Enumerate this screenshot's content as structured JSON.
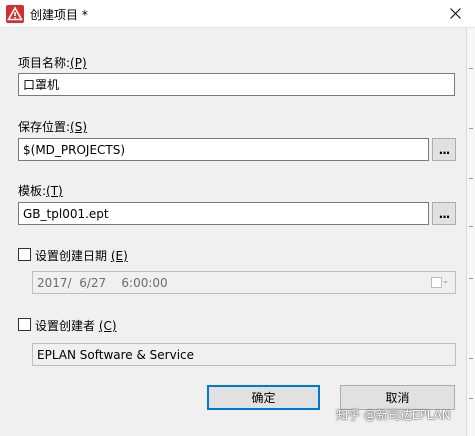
{
  "window": {
    "title": "创建项目 *",
    "icon": "eplan-warning-triangle-icon"
  },
  "project_name": {
    "label": "项目名称:",
    "accel": "(P)",
    "value": "口罩机"
  },
  "save_location": {
    "label": "保存位置:",
    "accel": "(S)",
    "value": "$(MD_PROJECTS)",
    "browse_label": "..."
  },
  "template": {
    "label": "模板:",
    "accel": "(T)",
    "value": "GB_tpl001.ept",
    "browse_label": "..."
  },
  "creation_date": {
    "label": "设置创建日期",
    "accel": "(E)",
    "checked": false,
    "value": "2017/  6/27    6:00:00"
  },
  "creator": {
    "label": "设置创建者",
    "accel": "(C)",
    "checked": false,
    "value": "EPLAN Software & Service"
  },
  "buttons": {
    "ok": "确定",
    "cancel": "取消"
  },
  "watermark": "知乎 @新司达EPLAN",
  "colors": {
    "accent": "#0078d7",
    "icon_red": "#d32f2f"
  }
}
